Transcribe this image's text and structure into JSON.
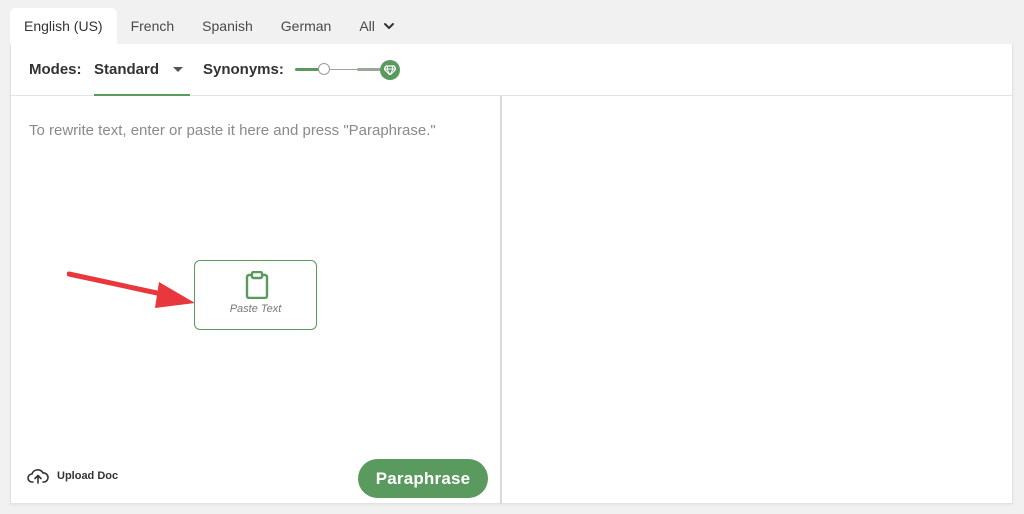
{
  "language_tabs": [
    {
      "label": "English (US)",
      "active": true
    },
    {
      "label": "French",
      "active": false
    },
    {
      "label": "Spanish",
      "active": false
    },
    {
      "label": "German",
      "active": false
    },
    {
      "label": "All",
      "active": false
    }
  ],
  "toolbar": {
    "modes_label": "Modes:",
    "mode_value": "Standard",
    "synonyms_label": "Synonyms:",
    "synonyms_level": 0.25
  },
  "editor": {
    "placeholder": "To rewrite text, enter or paste it here and press \"Paraphrase.\"",
    "paste_label": "Paste Text",
    "upload_label": "Upload Doc",
    "paraphrase_label": "Paraphrase"
  },
  "colors": {
    "accent": "#5a9a5f",
    "annotation_arrow": "#e8383d"
  },
  "icons": {
    "all_dropdown": "chevron-down-icon",
    "premium": "diamond-icon",
    "paste": "clipboard-icon",
    "upload": "cloud-upload-icon"
  }
}
